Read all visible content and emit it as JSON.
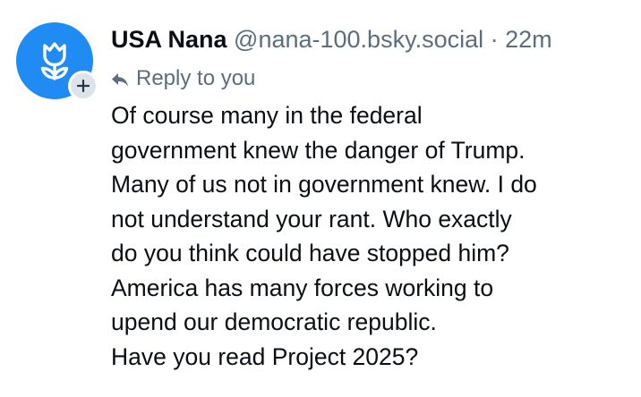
{
  "post": {
    "author": {
      "display_name": "USA Nana",
      "handle": "@nana-100.bsky.social",
      "avatar_icon": "tulip-icon",
      "avatar_color": "#1f8bf3"
    },
    "separator": "·",
    "timestamp": "22m",
    "reply_context": {
      "icon": "reply-arrow-icon",
      "label": "Reply to you"
    },
    "body_lines": [
      "Of course many in the federal",
      "government knew the danger of Trump.",
      "Many of us not in government knew. I do",
      "not understand your rant. Who exactly",
      "do you think could have stopped him?",
      "America has many forces working to",
      "upend our democratic republic.",
      "Have you read Project 2025?"
    ],
    "follow_badge_icon": "plus-icon"
  },
  "colors": {
    "text_primary": "#0b0f14",
    "text_secondary": "#5d6d7e",
    "badge_bg": "#dde3ea"
  }
}
